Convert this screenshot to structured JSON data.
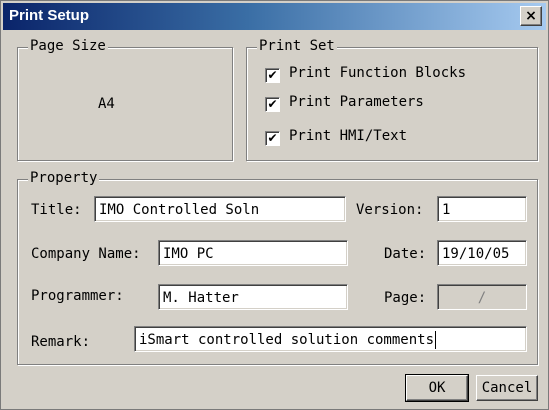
{
  "window": {
    "title": "Print Setup",
    "close_glyph": "×"
  },
  "page_size": {
    "legend": "Page Size",
    "value": "A4"
  },
  "print_set": {
    "legend": "Print Set",
    "items": [
      {
        "label": "Print Function Blocks",
        "checked": true,
        "mark": "✔"
      },
      {
        "label": "Print Parameters",
        "checked": true,
        "mark": "✔"
      },
      {
        "label": "Print HMI/Text",
        "checked": true,
        "mark": "✔"
      }
    ]
  },
  "property": {
    "legend": "Property",
    "title_label": "Title:",
    "title_value": "IMO Controlled Soln",
    "version_label": "Version:",
    "version_value": "1",
    "company_label": "Company Name:",
    "company_value": "IMO PC",
    "date_label": "Date:",
    "date_value": "19/10/05",
    "programmer_label": "Programmer:",
    "programmer_value": "M. Hatter",
    "page_label": "Page:",
    "page_value": "/",
    "remark_label": "Remark:",
    "remark_value": "iSmart controlled solution comments"
  },
  "buttons": {
    "ok": "OK",
    "cancel": "Cancel"
  }
}
